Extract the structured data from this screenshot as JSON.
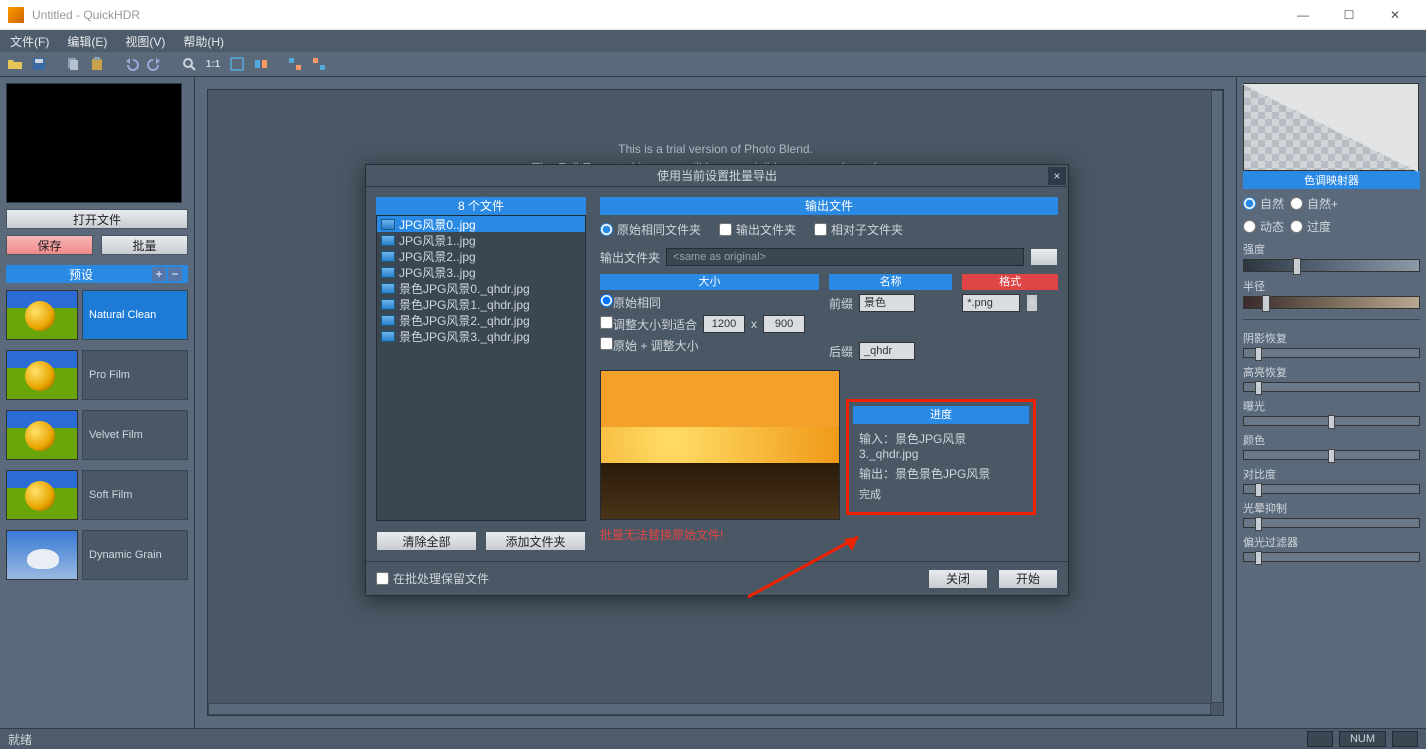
{
  "window": {
    "title": "Untitled - QuickHDR"
  },
  "menu": {
    "file": "文件(F)",
    "edit": "编辑(E)",
    "view": "视图(V)",
    "help": "帮助(H)"
  },
  "leftpanel": {
    "open": "打开文件",
    "save": "保存",
    "batch": "批量",
    "presets_title": "预设",
    "presets": [
      {
        "name": "Natural Clean"
      },
      {
        "name": "Pro Film"
      },
      {
        "name": "Velvet Film"
      },
      {
        "name": "Soft Film"
      },
      {
        "name": "Dynamic Grain"
      }
    ]
  },
  "trial": {
    "line1": "This is a trial version of Photo Blend.",
    "line2": "The Full Exported images will have a visible watermark on them"
  },
  "rightpanel": {
    "title": "色调映射器",
    "r_natural": "自然",
    "r_natural_plus": "自然+",
    "r_dynamic": "动态",
    "r_over": "过度",
    "strength": "强度",
    "radius": "半径",
    "shadow": "阴影恢复",
    "highlight": "高亮恢复",
    "exposure": "曝光",
    "color": "颜色",
    "contrast": "对比度",
    "halo": "光晕抑制",
    "polarize": "偏光过滤器"
  },
  "dialog": {
    "title": "使用当前设置批量导出",
    "files_head": "8 个文件",
    "files": [
      "JPG风景0..jpg",
      "JPG风景1..jpg",
      "JPG风景2..jpg",
      "JPG风景3..jpg",
      "景色JPG风景0._qhdr.jpg",
      "景色JPG风景1._qhdr.jpg",
      "景色JPG风景2._qhdr.jpg",
      "景色JPG风景3._qhdr.jpg"
    ],
    "clear": "清除全部",
    "add": "添加文件夹",
    "out_head": "输出文件",
    "r_same": "原始相同文件夹",
    "r_out": "输出文件夹",
    "r_rel": "相对子文件夹",
    "out_folder_label": "输出文件夹",
    "out_folder_value": "<same as original>",
    "size_head": "大小",
    "name_head": "名称",
    "fmt_head": "格式",
    "size_same": "原始相同",
    "size_fit": "调整大小到适合",
    "size_orig_fit": "原始 + 调整大小",
    "size_w": "1200",
    "size_h": "900",
    "size_x": "x",
    "prefix_lbl": "前缀",
    "prefix_val": "景色",
    "suffix_lbl": "后缀",
    "suffix_val": "_qhdr",
    "fmt_val": "*.png",
    "progress": {
      "head": "进度",
      "in_lbl": "输入：",
      "in_val": "景色JPG风景3._qhdr.jpg",
      "out_lbl": "输出：",
      "out_val": "景色景色JPG风景",
      "done": "完成"
    },
    "warn": "批量无法替换原始文件!",
    "keep": "在批处理保留文件",
    "close": "关闭",
    "start": "开始"
  },
  "status": {
    "ready": "就绪",
    "num": "NUM"
  },
  "toolbar_zoom": "1:1"
}
